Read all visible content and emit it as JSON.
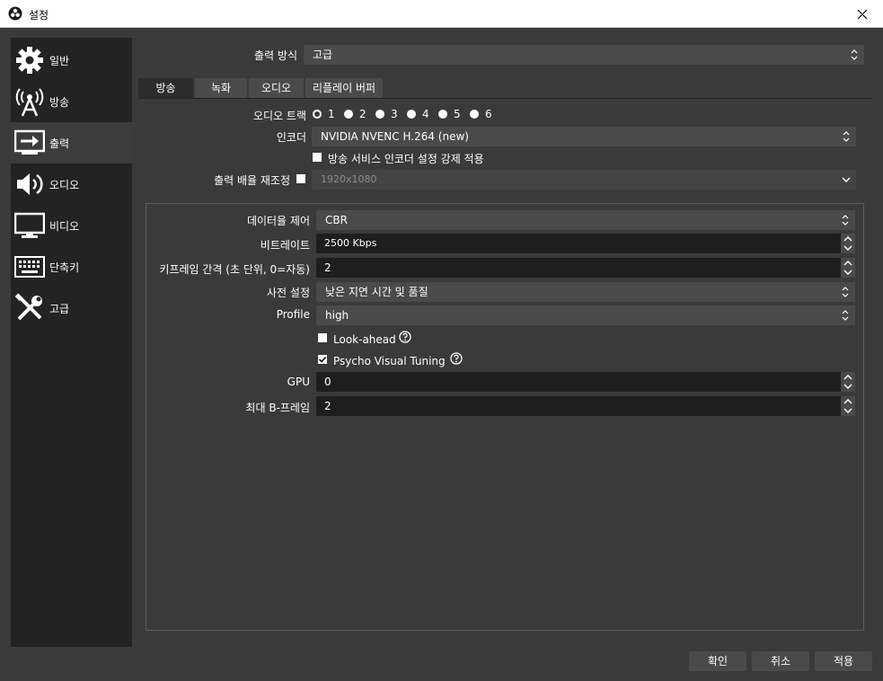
{
  "window": {
    "title": "설정"
  },
  "sidebar": {
    "items": [
      {
        "label": "일반",
        "icon": "gear-icon"
      },
      {
        "label": "방송",
        "icon": "broadcast-icon"
      },
      {
        "label": "출력",
        "icon": "output-icon"
      },
      {
        "label": "오디오",
        "icon": "speaker-icon"
      },
      {
        "label": "비디오",
        "icon": "monitor-icon"
      },
      {
        "label": "단축키",
        "icon": "keyboard-icon"
      },
      {
        "label": "고급",
        "icon": "tools-icon"
      }
    ],
    "active_index": 2
  },
  "output_mode": {
    "label": "출력 방식",
    "value": "고급"
  },
  "tabs": [
    {
      "label": "방송"
    },
    {
      "label": "녹화"
    },
    {
      "label": "오디오"
    },
    {
      "label": "리플레이 버퍼"
    }
  ],
  "streaming": {
    "audio_track": {
      "label": "오디오 트랙",
      "options": [
        "1",
        "2",
        "3",
        "4",
        "5",
        "6"
      ],
      "selected": "1"
    },
    "encoder": {
      "label": "인코더",
      "value": "NVIDIA NVENC H.264 (new)"
    },
    "enforce_encoder": {
      "label": "방송 서비스 인코더 설정 강제 적용",
      "checked": false
    },
    "rescale": {
      "label": "출력 배율 재조정",
      "value": "1920x1080",
      "checked": false
    }
  },
  "encoder_settings": {
    "rate_control": {
      "label": "데이터율 제어",
      "value": "CBR"
    },
    "bitrate": {
      "label": "비트레이트",
      "value": "2500 Kbps"
    },
    "keyframe_interval": {
      "label": "키프레임 간격 (초 단위, 0=자동)",
      "value": "2"
    },
    "preset": {
      "label": "사전 설정",
      "value": "낮은 지연 시간 및 품질"
    },
    "profile": {
      "label": "Profile",
      "value": "high"
    },
    "look_ahead": {
      "label": "Look-ahead",
      "checked": false
    },
    "psycho_visual": {
      "label": "Psycho Visual Tuning",
      "checked": true
    },
    "gpu": {
      "label": "GPU",
      "value": "0"
    },
    "max_bframes": {
      "label": "최대 B-프레임",
      "value": "2"
    }
  },
  "footer": {
    "ok_label": "확인",
    "cancel_label": "취소",
    "apply_label": "적용"
  }
}
